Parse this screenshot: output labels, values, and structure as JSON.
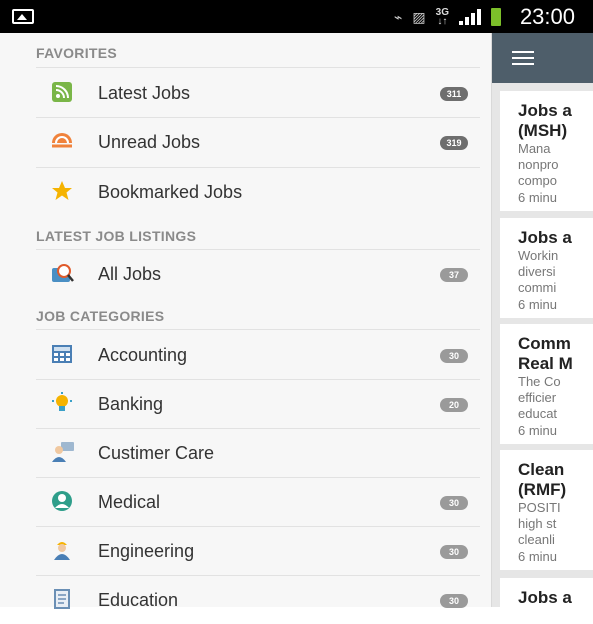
{
  "status_bar": {
    "time": "23:00",
    "network": "3G",
    "sub": "↓↑"
  },
  "drawer": {
    "sections": [
      {
        "title": "FAVORITES"
      },
      {
        "title": "LATEST JOB LISTINGS"
      },
      {
        "title": "JOB CATEGORIES"
      }
    ],
    "items": [
      {
        "label": "Latest Jobs",
        "badge": "311",
        "icon": "rss-icon",
        "color": "#7ab648"
      },
      {
        "label": "Unread Jobs",
        "badge": "319",
        "icon": "wifi-icon",
        "color": "#f0823b"
      },
      {
        "label": "Bookmarked Jobs",
        "badge": "",
        "icon": "star-icon",
        "color": "#f5b301"
      },
      {
        "label": "All Jobs",
        "badge": "37",
        "icon": "search-icon",
        "color": "#4a8fc4"
      },
      {
        "label": "Accounting",
        "badge": "30",
        "icon": "calculator-icon",
        "color": "#4a7fb5"
      },
      {
        "label": "Banking",
        "badge": "20",
        "icon": "lightbulb-icon",
        "color": "#3aa0c8"
      },
      {
        "label": "Custimer Care",
        "badge": "",
        "icon": "support-icon",
        "color": "#4a7fb5"
      },
      {
        "label": "Medical",
        "badge": "30",
        "icon": "doctor-icon",
        "color": "#2e9e8a"
      },
      {
        "label": "Engineering",
        "badge": "30",
        "icon": "engineer-icon",
        "color": "#4a7fb5"
      },
      {
        "label": "Education",
        "badge": "30",
        "icon": "book-icon",
        "color": "#6a8fb5"
      }
    ]
  },
  "content": {
    "cards": [
      {
        "title1": "Jobs a",
        "title2": "(MSH)",
        "desc": [
          " Mana",
          "nonpro",
          "compo"
        ],
        "time": "6 minu"
      },
      {
        "title1": "Jobs a",
        "title2": "",
        "desc": [
          "Workin",
          "diversi",
          "commi"
        ],
        "time": "6 minu"
      },
      {
        "title1": "Comm",
        "title2": "Real M",
        "desc": [
          "The Co",
          "efficier",
          "educat"
        ],
        "time": "6 minu"
      },
      {
        "title1": "Clean",
        "title2": "(RMF)",
        "desc": [
          "POSITI",
          "high st",
          "cleanli"
        ],
        "time": "6 minu"
      },
      {
        "title1": "Jobs a",
        "title2": "",
        "desc": [],
        "time": ""
      }
    ]
  },
  "colors": {
    "app_bar": "#4e5e6a",
    "drawer_bg": "#f7f7f7",
    "badge": "#9a9a9a"
  }
}
